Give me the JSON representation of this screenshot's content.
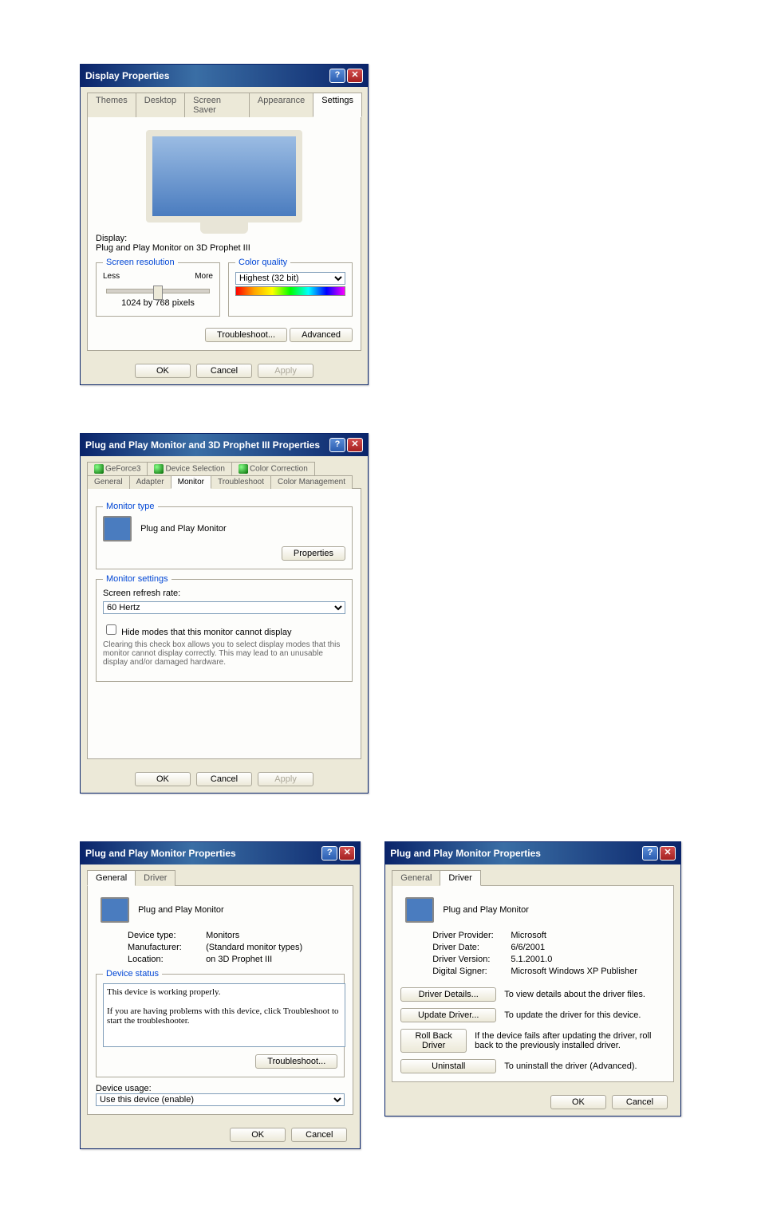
{
  "win1": {
    "title": "Display Properties",
    "tabs": [
      "Themes",
      "Desktop",
      "Screen Saver",
      "Appearance",
      "Settings"
    ],
    "active_tab": "Settings",
    "display_label": "Display:",
    "display_value": "Plug and Play Monitor on 3D Prophet III",
    "screenres_legend": "Screen resolution",
    "less": "Less",
    "more": "More",
    "res_value": "1024 by 768 pixels",
    "colorq_legend": "Color quality",
    "colorq_value": "Highest (32 bit)",
    "troubleshoot": "Troubleshoot...",
    "advanced": "Advanced",
    "ok": "OK",
    "cancel": "Cancel",
    "apply": "Apply"
  },
  "win2": {
    "title": "Plug and Play Monitor and 3D Prophet III Properties",
    "tabs_row1": [
      "GeForce3",
      "Device Selection",
      "Color Correction"
    ],
    "tabs_row2": [
      "General",
      "Adapter",
      "Monitor",
      "Troubleshoot",
      "Color Management"
    ],
    "active_tab": "Monitor",
    "montype_legend": "Monitor type",
    "montype_value": "Plug and Play Monitor",
    "properties": "Properties",
    "monset_legend": "Monitor settings",
    "refresh_label": "Screen refresh rate:",
    "refresh_value": "60 Hertz",
    "hide_modes": "Hide modes that this monitor cannot display",
    "hide_help": "Clearing this check box allows you to select display modes that this monitor cannot display correctly. This may lead to an unusable display and/or damaged hardware.",
    "ok": "OK",
    "cancel": "Cancel",
    "apply": "Apply"
  },
  "win3": {
    "title": "Plug and Play Monitor Properties",
    "tabs": [
      "General",
      "Driver"
    ],
    "active_tab": "General",
    "device_name": "Plug and Play Monitor",
    "devtype_label": "Device type:",
    "devtype_value": "Monitors",
    "manu_label": "Manufacturer:",
    "manu_value": "(Standard monitor types)",
    "loc_label": "Location:",
    "loc_value": "on 3D Prophet III",
    "devstatus_legend": "Device status",
    "status_text": "This device is working properly.\n\nIf you are having problems with this device, click Troubleshoot to start the troubleshooter.",
    "troubleshoot": "Troubleshoot...",
    "usage_label": "Device usage:",
    "usage_value": "Use this device (enable)",
    "ok": "OK",
    "cancel": "Cancel"
  },
  "win4": {
    "title": "Plug and Play Monitor Properties",
    "tabs": [
      "General",
      "Driver"
    ],
    "active_tab": "Driver",
    "device_name": "Plug and Play Monitor",
    "provider_label": "Driver Provider:",
    "provider_value": "Microsoft",
    "date_label": "Driver Date:",
    "date_value": "6/6/2001",
    "version_label": "Driver Version:",
    "version_value": "5.1.2001.0",
    "signer_label": "Digital Signer:",
    "signer_value": "Microsoft Windows XP Publisher",
    "details_btn": "Driver Details...",
    "details_help": "To view details about the driver files.",
    "update_btn": "Update Driver...",
    "update_help": "To update the driver for this device.",
    "rollback_btn": "Roll Back Driver",
    "rollback_help": "If the device fails after updating the driver, roll back to the previously installed driver.",
    "uninstall_btn": "Uninstall",
    "uninstall_help": "To uninstall the driver (Advanced).",
    "ok": "OK",
    "cancel": "Cancel"
  }
}
